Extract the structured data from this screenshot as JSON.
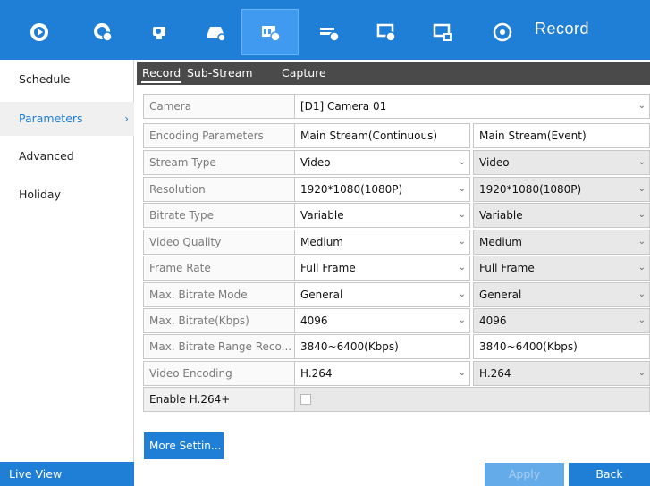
{
  "window": {
    "title": "Record"
  },
  "toolbar": {
    "icons": [
      "live-view-icon",
      "playback-icon",
      "camera-icon",
      "storage-icon",
      "record-icon",
      "network-icon",
      "system-icon",
      "maintenance-icon",
      "shutdown-icon"
    ]
  },
  "sidebar": {
    "items": [
      {
        "label": "Schedule"
      },
      {
        "label": "Parameters",
        "chevron": "›"
      },
      {
        "label": "Advanced"
      },
      {
        "label": "Holiday"
      }
    ],
    "live_view": "Live View"
  },
  "tabs": [
    {
      "label": "Record"
    },
    {
      "label": "Sub-Stream"
    },
    {
      "label": "Capture"
    }
  ],
  "form": {
    "camera": {
      "label": "Camera",
      "value": "[D1] Camera 01"
    },
    "header": {
      "label": "Encoding Parameters",
      "col1": "Main Stream(Continuous)",
      "col2": "Main Stream(Event)"
    },
    "rows": [
      {
        "label": "Stream Type",
        "col1": "Video",
        "col2": "Video"
      },
      {
        "label": "Resolution",
        "col1": "1920*1080(1080P)",
        "col2": "1920*1080(1080P)"
      },
      {
        "label": "Bitrate Type",
        "col1": "Variable",
        "col2": "Variable"
      },
      {
        "label": "Video Quality",
        "col1": "Medium",
        "col2": "Medium"
      },
      {
        "label": "Frame Rate",
        "col1": "Full Frame",
        "col2": "Full Frame"
      },
      {
        "label": "Max. Bitrate Mode",
        "col1": "General",
        "col2": "General"
      },
      {
        "label": "Max. Bitrate(Kbps)",
        "col1": "4096",
        "col2": "4096"
      },
      {
        "label": "Max. Bitrate Range Reco...",
        "col1": "3840~6400(Kbps)",
        "col2": "3840~6400(Kbps)"
      },
      {
        "label": "Video Encoding",
        "col1": "H.264",
        "col2": "H.264"
      }
    ],
    "enable_h264plus": {
      "label": "Enable H.264+",
      "checked": false
    }
  },
  "buttons": {
    "more_settings": "More Settin...",
    "apply": "Apply",
    "back": "Back"
  },
  "colors": {
    "accent": "#1f7fd6",
    "tab_bar": "#4a4a4a"
  }
}
